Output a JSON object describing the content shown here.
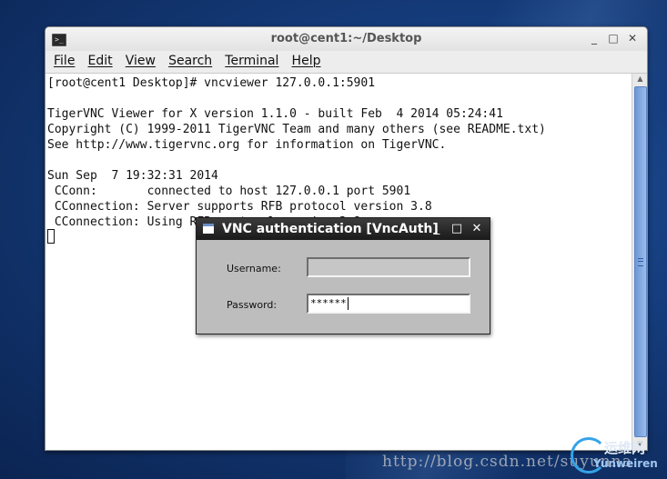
{
  "terminal": {
    "title": "root@cent1:~/Desktop",
    "icon": "terminal-icon",
    "window_buttons": {
      "minimize": "_",
      "maximize": "□",
      "close": "✕"
    },
    "menu": [
      "File",
      "Edit",
      "View",
      "Search",
      "Terminal",
      "Help"
    ],
    "lines": [
      "[root@cent1 Desktop]# vncviewer 127.0.0.1:5901",
      "",
      "TigerVNC Viewer for X version 1.1.0 - built Feb  4 2014 05:24:41",
      "Copyright (C) 1999-2011 TigerVNC Team and many others (see README.txt)",
      "See http://www.tigervnc.org for information on TigerVNC.",
      "",
      "Sun Sep  7 19:32:31 2014",
      " CConn:       connected to host 127.0.0.1 port 5901",
      " CConnection: Server supports RFB protocol version 3.8",
      " CConnection: Using RFB protocol version 3.8"
    ]
  },
  "vnc_dialog": {
    "title": "VNC authentication [VncAuth]",
    "icon": "window-icon",
    "window_buttons": {
      "minimize": "_",
      "maximize": "□",
      "close": "✕"
    },
    "username_label": "Username:",
    "username_value": "",
    "password_label": "Password:",
    "password_value": "******"
  },
  "watermark": {
    "url": "http://blog.csdn.net/suyunna",
    "logo_text": "运维网",
    "logo_sub": "Yunweiren"
  }
}
